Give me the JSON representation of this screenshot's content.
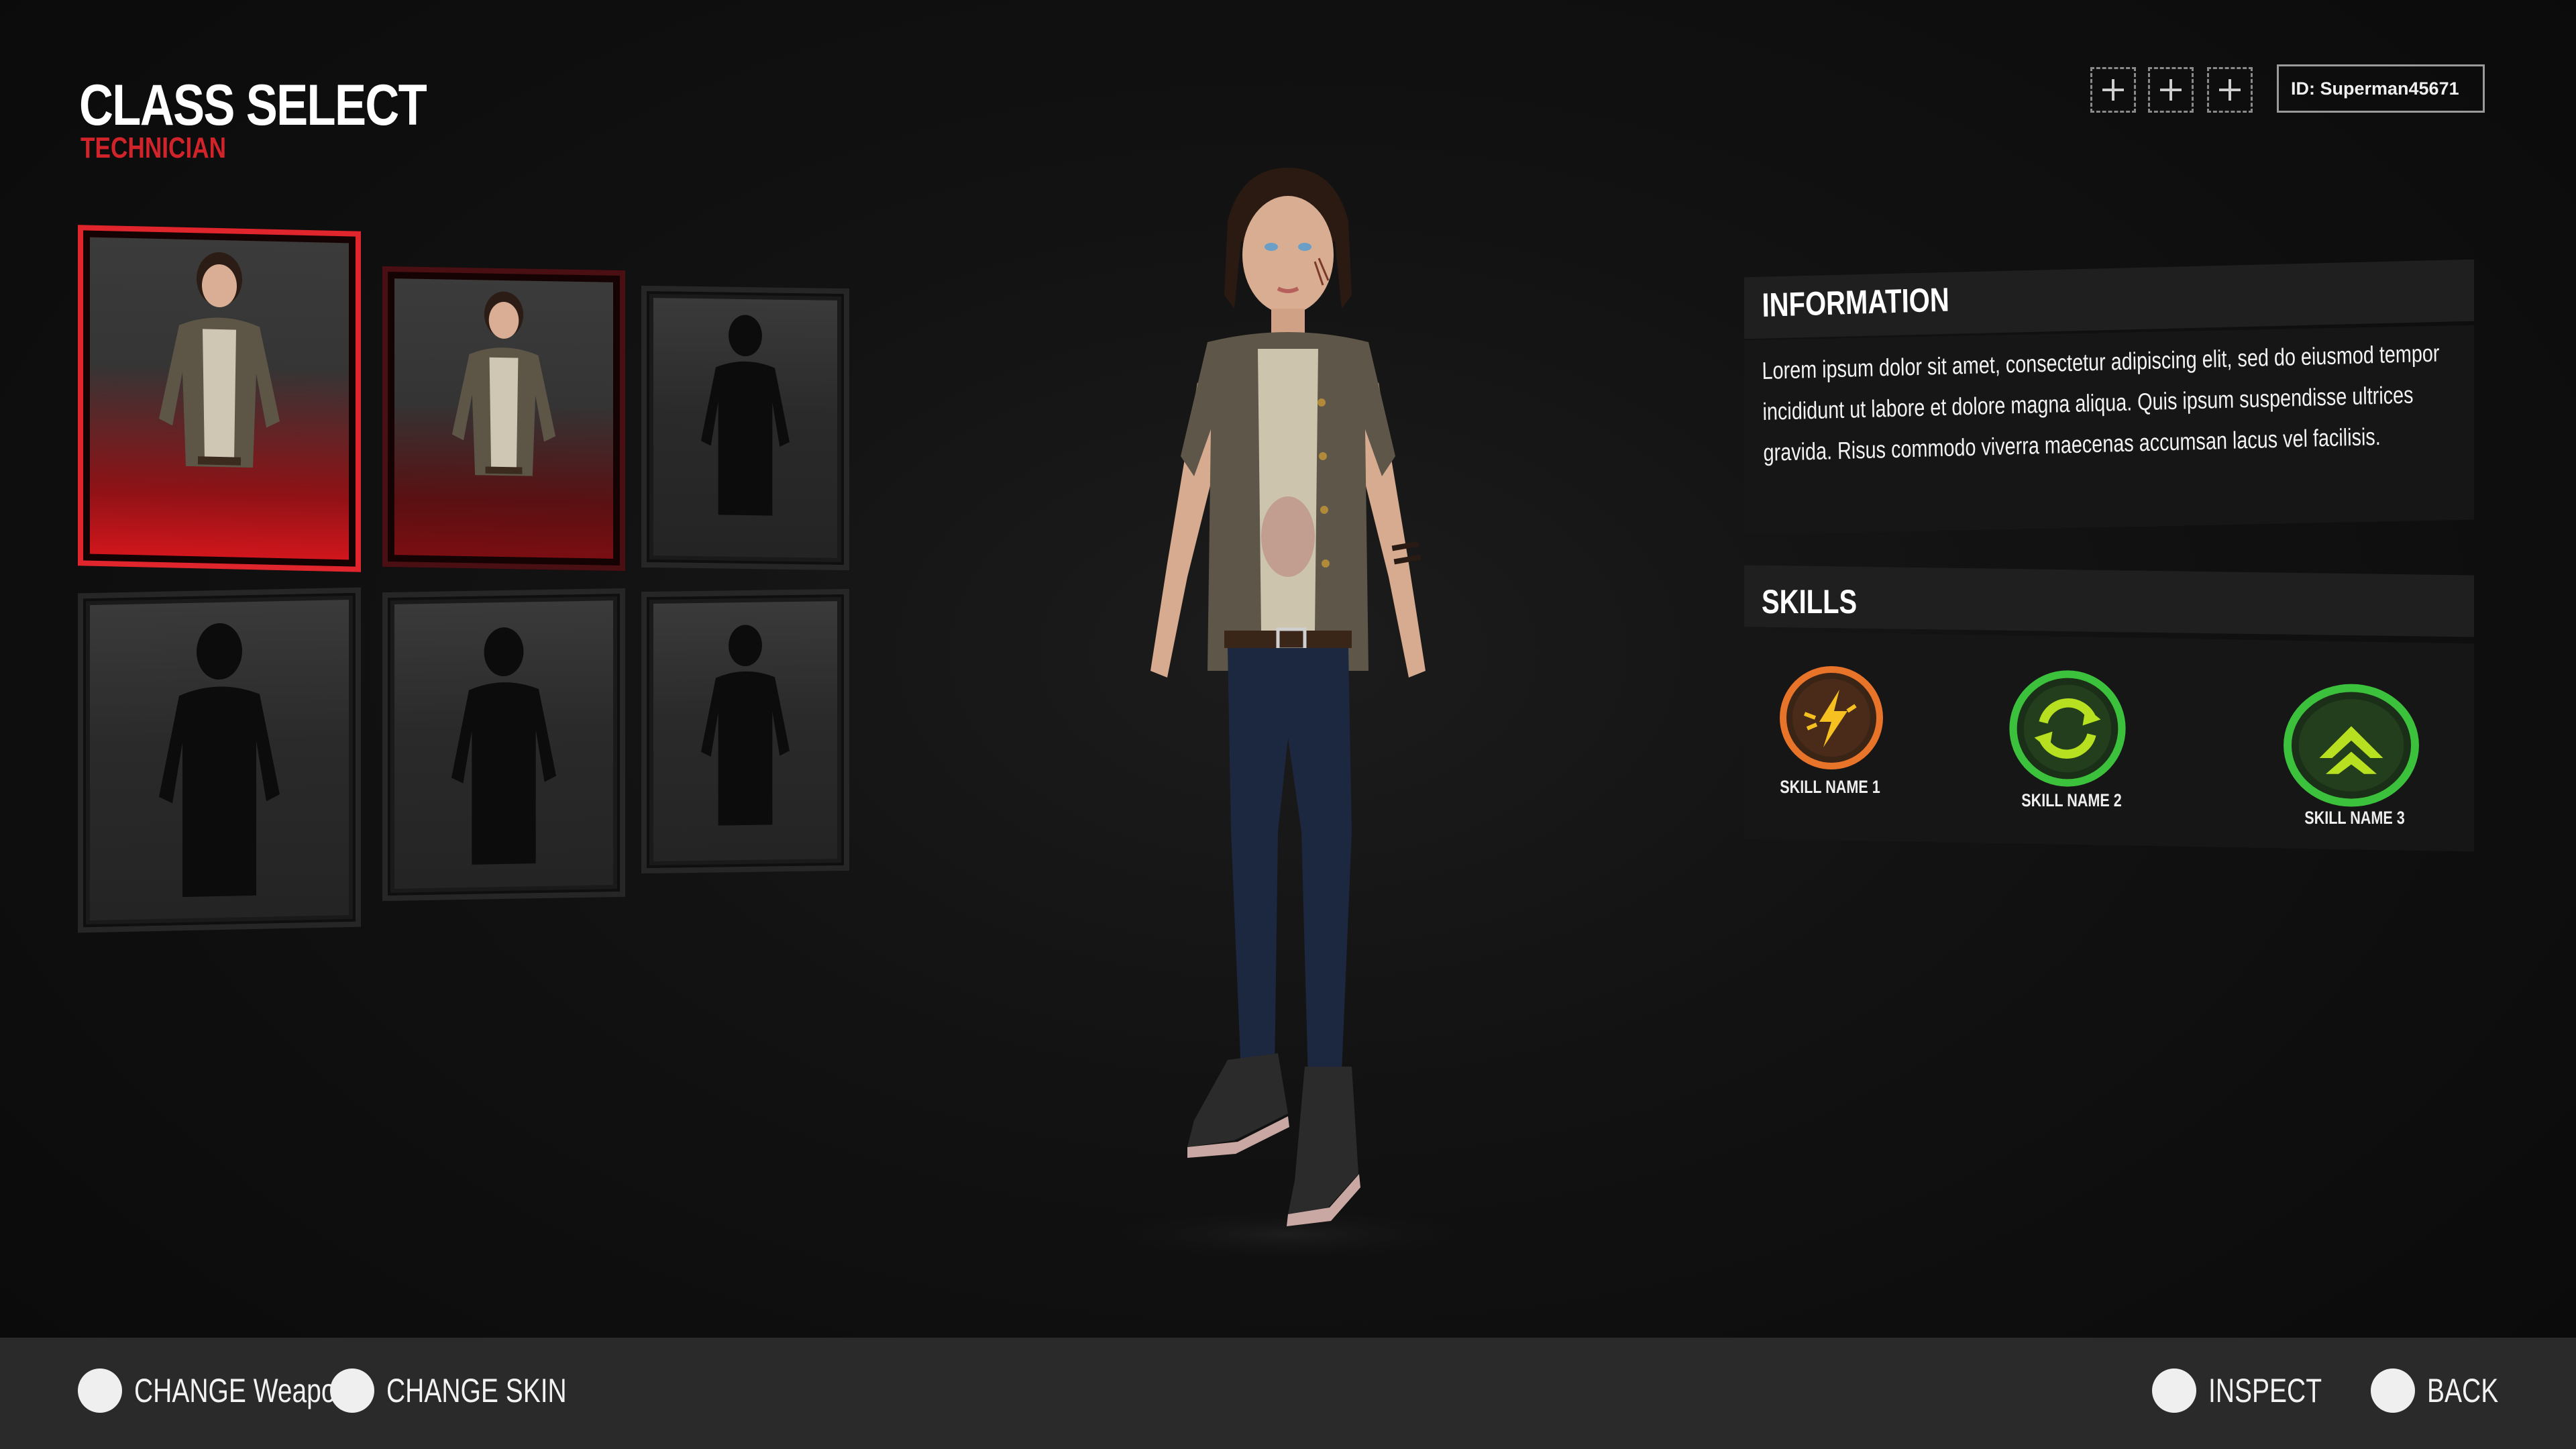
{
  "header": {
    "title": "CLASS SELECT",
    "subtitle": "TECHNICIAN"
  },
  "topbar": {
    "plus_buttons": [
      "add-slot-1",
      "add-slot-2",
      "add-slot-3"
    ],
    "player_id": "ID: Superman45671"
  },
  "character_cards": [
    {
      "state": "selected",
      "portrait": "technician-portrait"
    },
    {
      "state": "unlocked",
      "portrait": "technician-portrait"
    },
    {
      "state": "locked",
      "portrait": "silhouette"
    },
    {
      "state": "locked",
      "portrait": "silhouette"
    },
    {
      "state": "locked",
      "portrait": "silhouette"
    },
    {
      "state": "locked",
      "portrait": "silhouette"
    }
  ],
  "information": {
    "title": "INFORMATION",
    "body": "Lorem ipsum dolor sit amet, consectetur adipiscing elit, sed do eiusmod tempor incididunt ut labore et dolore magna aliqua. Quis ipsum suspendisse ultrices gravida. Risus commodo viverra maecenas accumsan lacus vel facilisis."
  },
  "skills": {
    "title": "SKILLS",
    "items": [
      {
        "name": "SKILL NAME 1",
        "icon": "lightning-burst-icon",
        "color": "#e8742a"
      },
      {
        "name": "SKILL NAME 2",
        "icon": "refresh-cycle-icon",
        "color": "#3cc13c"
      },
      {
        "name": "SKILL NAME 3",
        "icon": "chevron-up-icon",
        "color": "#3cc13c"
      }
    ]
  },
  "prompts": {
    "change_weapon": "CHANGE Weapon",
    "change_skin": "CHANGE SKIN",
    "inspect": "INSPECT",
    "back": "BACK"
  },
  "colors": {
    "accent": "#d1232a",
    "background": "#111111",
    "bottom_bar": "#2a2a2a"
  }
}
